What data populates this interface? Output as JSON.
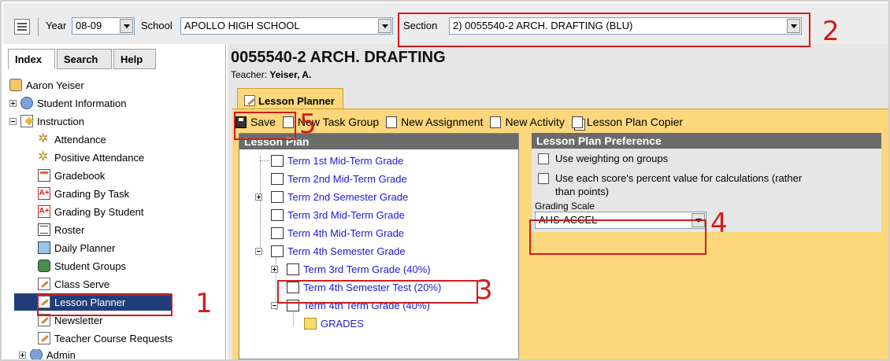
{
  "topbar": {
    "year_label": "Year",
    "year_value": "08-09",
    "school_label": "School",
    "school_value": "APOLLO HIGH SCHOOL",
    "section_label": "Section",
    "section_value": "2) 0055540-2 ARCH. DRAFTING (BLU)"
  },
  "left_tabs": [
    "Index",
    "Search",
    "Help"
  ],
  "tree": {
    "user": "Aaron Yeiser",
    "items": [
      "Student Information",
      "Instruction",
      "Attendance",
      "Positive Attendance",
      "Gradebook",
      "Grading By Task",
      "Grading By Student",
      "Roster",
      "Daily Planner",
      "Student Groups",
      "Class Serve",
      "Lesson Planner",
      "Newsletter",
      "Teacher Course Requests",
      "Admin"
    ]
  },
  "main": {
    "course_title": "0055540-2 ARCH. DRAFTING",
    "teacher_label": "Teacher:",
    "teacher_name": "Yeiser, A.",
    "tab_label": "Lesson Planner",
    "toolbar": {
      "save": "Save",
      "new_task_group": "New Task Group",
      "new_assignment": "New Assignment",
      "new_activity": "New Activity",
      "copier": "Lesson Plan Copier"
    },
    "lesson_plan_header": "Lesson Plan",
    "lesson_items": [
      "Term 1st Mid-Term Grade",
      "Term 2nd Mid-Term Grade",
      "Term 2nd Semester Grade",
      "Term 3rd Mid-Term Grade",
      "Term 4th Mid-Term Grade",
      "Term 4th Semester Grade",
      "Term 3rd Term Grade (40%)",
      "Term 4th Semester Test (20%)",
      "Term 4th Term Grade (40%)",
      "GRADES"
    ],
    "pref": {
      "header": "Lesson Plan Preference",
      "opt1": "Use weighting on groups",
      "opt2_line1": "Use each score's percent value for calculations (rather",
      "opt2_line2": "than points)",
      "grading_scale_label": "Grading Scale",
      "grading_scale_value": "AHS-ACCEL"
    }
  },
  "annotations": [
    "1",
    "2",
    "3",
    "4",
    "5"
  ],
  "colors": {
    "accent_orange": "#fcd77c",
    "annotation_red": "#d11c1c",
    "selection_blue": "#1f3e7a",
    "link_blue": "#1a1ad6"
  }
}
